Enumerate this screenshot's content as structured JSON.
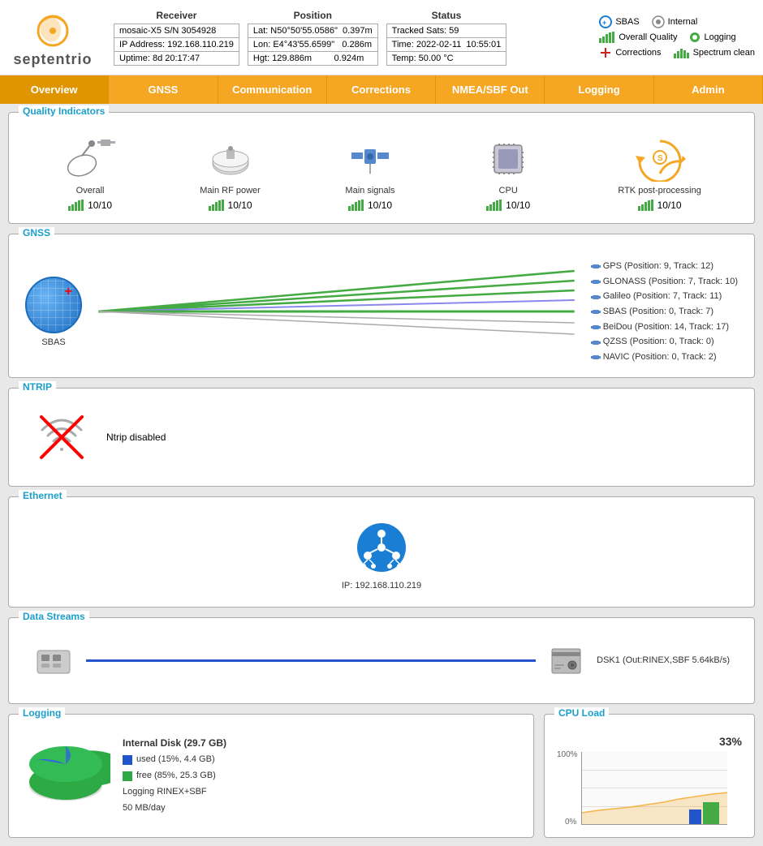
{
  "header": {
    "logo_text": "septentrio",
    "receiver": {
      "title": "Receiver",
      "rows": [
        [
          "mosaic-X5 S/N 3054928"
        ],
        [
          "IP Address: 192.168.110.219"
        ],
        [
          "Uptime: 8d 20:17:47"
        ]
      ]
    },
    "position": {
      "title": "Position",
      "rows": [
        [
          "Lat:",
          "N50°50'55.0586\"",
          "0.397m"
        ],
        [
          "Lon:",
          "E4°43'55.6599\"",
          "0.286m"
        ],
        [
          "Hgt:",
          "129.886m",
          "0.924m"
        ]
      ]
    },
    "status": {
      "title": "Status",
      "rows": [
        [
          "Tracked Sats: 59"
        ],
        [
          "Time: 2022-02-11  10:55:01"
        ],
        [
          "Temp: 50.00 °C"
        ]
      ]
    },
    "status_icons": {
      "row1": [
        {
          "icon": "sbas",
          "label": "SBAS"
        },
        {
          "icon": "internal",
          "label": "Internal"
        }
      ],
      "row2": [
        {
          "icon": "overall-quality",
          "label": "Overall Quality"
        },
        {
          "icon": "logging",
          "label": "Logging"
        }
      ],
      "row3": [
        {
          "icon": "corrections",
          "label": "Corrections"
        },
        {
          "icon": "spectrum",
          "label": "Spectrum clean"
        }
      ]
    }
  },
  "nav": {
    "items": [
      "Overview",
      "GNSS",
      "Communication",
      "Corrections",
      "NMEA/SBF Out",
      "Logging",
      "Admin"
    ]
  },
  "quality": {
    "title": "Quality Indicators",
    "items": [
      {
        "label": "Overall",
        "score": "10/10"
      },
      {
        "label": "Main RF power",
        "score": "10/10"
      },
      {
        "label": "Main signals",
        "score": "10/10"
      },
      {
        "label": "CPU",
        "score": "10/10"
      },
      {
        "label": "RTK post-processing",
        "score": "10/10"
      }
    ]
  },
  "gnss": {
    "title": "GNSS",
    "globe_label": "SBAS",
    "satellites": [
      "GPS (Position: 9, Track: 12)",
      "GLONASS (Position: 7, Track: 10)",
      "Galileo (Position: 7, Track: 11)",
      "SBAS (Position: 0, Track: 7)",
      "BeiDou (Position: 14, Track: 17)",
      "QZSS (Position: 0, Track: 0)",
      "NAVIC (Position: 0, Track: 2)"
    ]
  },
  "ntrip": {
    "title": "NTRIP",
    "status": "Ntrip disabled"
  },
  "ethernet": {
    "title": "Ethernet",
    "ip": "IP: 192.168.110.219"
  },
  "datastreams": {
    "title": "Data Streams",
    "label": "DSK1 (Out:RINEX,SBF 5.64kB/s)"
  },
  "logging": {
    "title": "Logging",
    "disk_title": "Internal Disk (29.7 GB)",
    "used_label": "used (15%, 4.4 GB)",
    "free_label": "free (85%, 25.3 GB)",
    "rate_label": "Logging RINEX+SBF",
    "rate_value": "50 MB/day",
    "used_pct": 15,
    "free_pct": 85
  },
  "cpu": {
    "title": "CPU Load",
    "percentage": "33%",
    "label_100": "100%",
    "label_0": "0%"
  }
}
